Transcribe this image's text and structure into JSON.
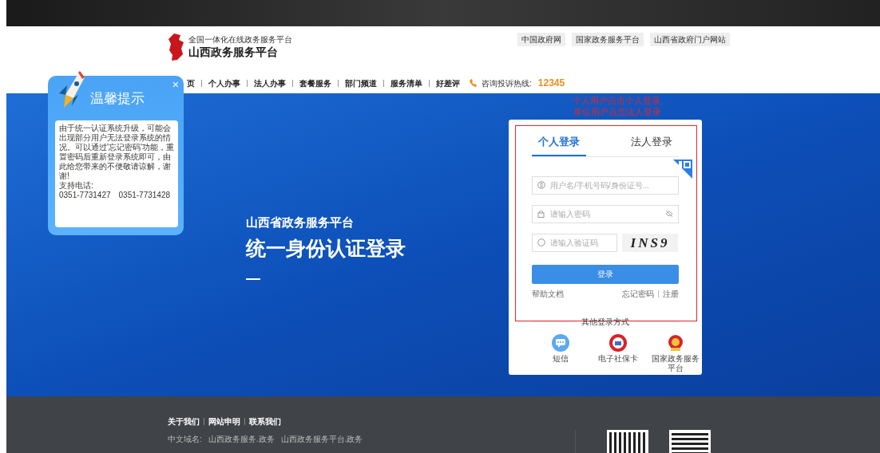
{
  "header": {
    "tagline": "全国一体化在线政务服务平台",
    "site_name": "山西政务服务平台",
    "links": [
      "中国政府网",
      "国家政务服务平台",
      "山西省政府门户网站"
    ]
  },
  "nav": {
    "items": [
      "页",
      "个人办事",
      "法人办事",
      "套餐服务",
      "部门频道",
      "服务清单",
      "好差评"
    ],
    "hotline_label": "咨询投诉热线:",
    "hotline": "12345"
  },
  "notice_popup": {
    "title": "温馨提示",
    "close": "×",
    "body": "由于统一认证系统升级，可能会出现部分用户无法登录系统的情况。可以通过'忘记密码'功能，重置密码后重新登录系统即可，由此给您带来的不便敬请谅解，谢谢!",
    "phone_label": "支持电话:",
    "phones": [
      "0351-7731427",
      "0351-7731428"
    ]
  },
  "hero": {
    "subtitle": "山西省政务服务平台",
    "title": "统一身份认证登录"
  },
  "annotation": [
    "个人用户点击个人登录,",
    "单位用户点击法人登录"
  ],
  "login": {
    "tabs": [
      {
        "label": "个人登录",
        "selected": true
      },
      {
        "label": "法人登录",
        "selected": false
      }
    ],
    "fields": [
      {
        "kind": "username",
        "placeholder": "用户名/手机号码/身份证号..."
      },
      {
        "kind": "password",
        "placeholder": "请输入密码"
      },
      {
        "kind": "captcha",
        "placeholder": "请输入验证码",
        "captcha": "INS9"
      }
    ],
    "submit": "登录",
    "help": "帮助文档",
    "forgot": "忘记密码",
    "register": "注册",
    "other_title": "其他登录方式",
    "other_methods": [
      {
        "kind": "sms",
        "label": "短信"
      },
      {
        "kind": "social_card",
        "label": "电子社保卡"
      },
      {
        "kind": "national",
        "label": "国家政务服务平台"
      }
    ]
  },
  "footer": {
    "links": [
      "关于我们",
      "网站申明",
      "联系我们"
    ],
    "domain_label": "中文域名:",
    "domains": [
      "山西政务服务.政务",
      "山西政务服务平台.政务"
    ]
  }
}
